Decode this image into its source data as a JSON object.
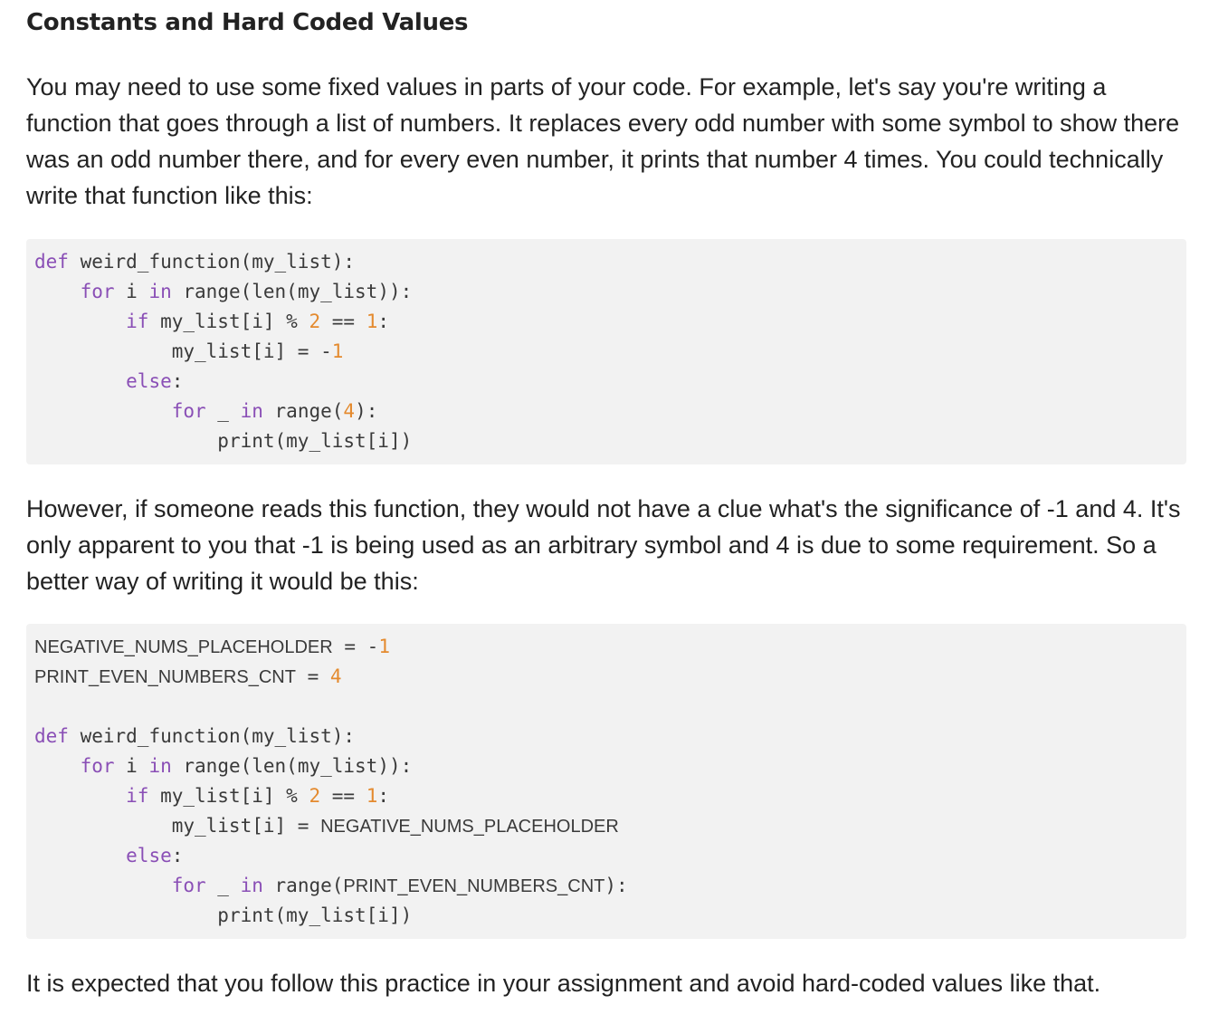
{
  "title": "Constants and Hard Coded Values",
  "paragraphs": {
    "intro": "You may need to use some fixed values in parts of your code. For example, let's say you're writing a function that goes through a list of numbers. It replaces every odd number with some symbol to show there was an odd number there, and for every even number, it prints that number 4 times. You could technically write that function like this:",
    "middle": "However, if someone reads this function, they would not have a clue what's the significance of -1 and 4. It's only apparent to you that -1 is being used as an arbitrary symbol and 4 is due to some requirement. So a better way of writing it would be this:",
    "outro": "It is expected that you follow this practice in your assignment and avoid hard-coded values like that."
  },
  "code": {
    "kw": {
      "def": "def",
      "for": "for",
      "in": "in",
      "if": "if",
      "else": "else"
    },
    "names": {
      "func_sig": " weird_function(my_list):",
      "i_var": " i ",
      "range_len": " range(len(my_list)):",
      "cond": " my_list[i] % ",
      "two": "2",
      "eq": " == ",
      "one": "1",
      "colon": ":",
      "assign": "my_list[i] = ",
      "neg": "-",
      "else_colon": ":",
      "underscore": " _ ",
      "range_open": " range(",
      "four": "4",
      "range_close": "):",
      "print": "print(my_list[i])",
      "const_neg": "NEGATIVE_NUMS_PLACEHOLDER",
      "const_cnt": "PRINT_EVEN_NUMBERS_CNT",
      "eq_assign": " = ",
      "eq_assign_pad": "  = "
    }
  }
}
